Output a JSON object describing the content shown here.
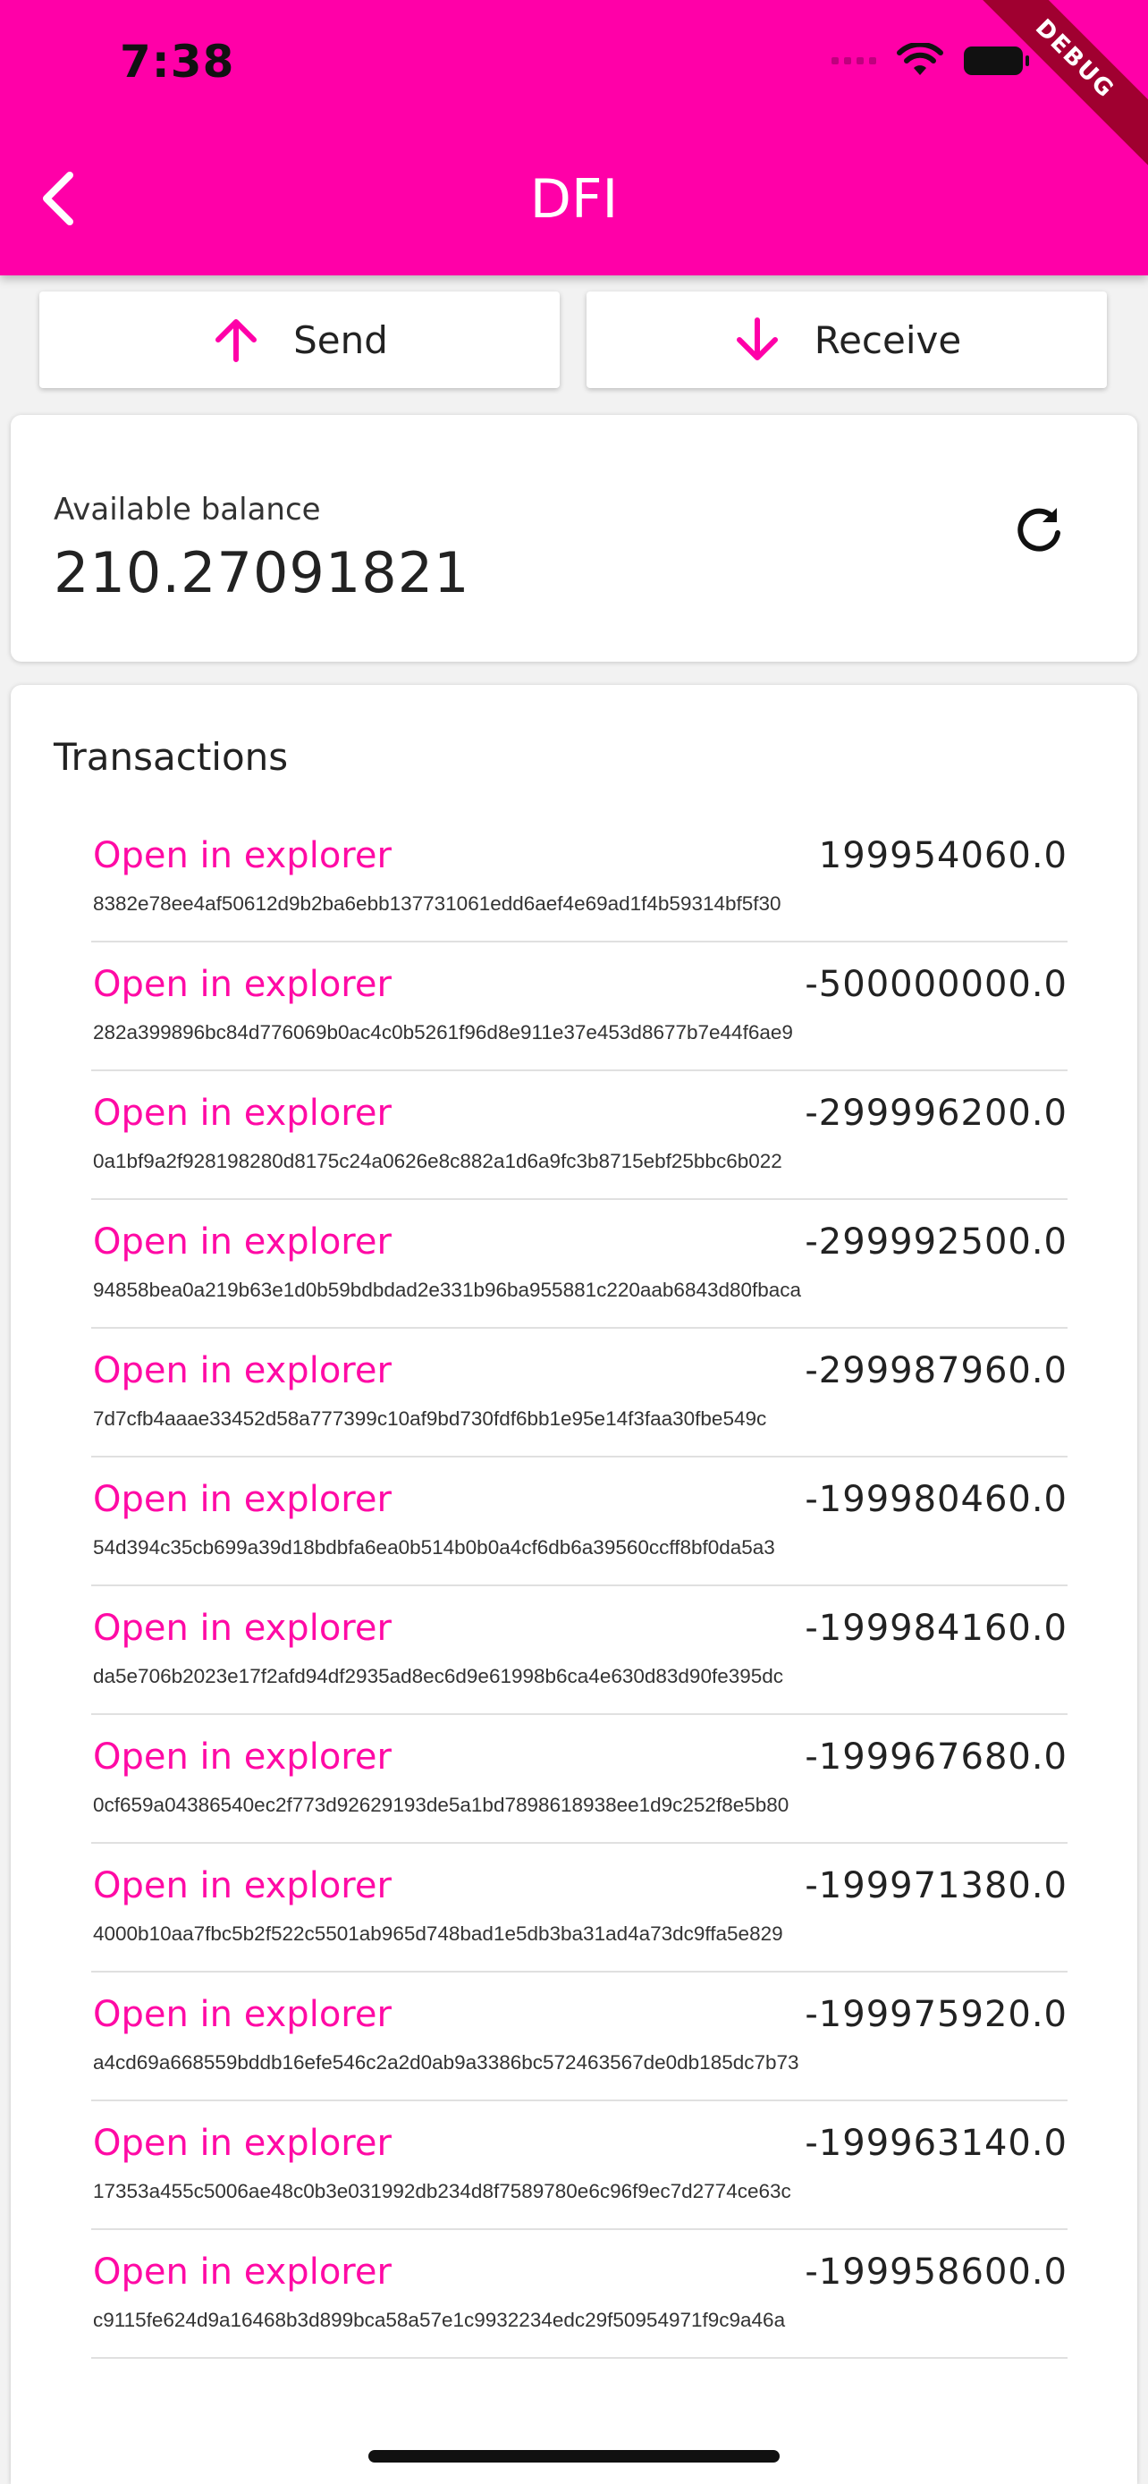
{
  "status_bar": {
    "time": "7:38"
  },
  "debug_banner": "DEBUG",
  "app_bar": {
    "title": "DFI"
  },
  "actions": {
    "send_label": "Send",
    "receive_label": "Receive"
  },
  "balance": {
    "label": "Available balance",
    "value": "210.27091821"
  },
  "transactions": {
    "heading": "Transactions",
    "link_label": "Open in explorer",
    "items": [
      {
        "amount": "199954060.0",
        "hash": "8382e78ee4af50612d9b2ba6ebb137731061edd6aef4e69ad1f4b59314bf5f30"
      },
      {
        "amount": "-500000000.0",
        "hash": "282a399896bc84d776069b0ac4c0b5261f96d8e911e37e453d8677b7e44f6ae9"
      },
      {
        "amount": "-299996200.0",
        "hash": "0a1bf9a2f928198280d8175c24a0626e8c882a1d6a9fc3b8715ebf25bbc6b022"
      },
      {
        "amount": "-299992500.0",
        "hash": "94858bea0a219b63e1d0b59bdbdad2e331b96ba955881c220aab6843d80fbaca"
      },
      {
        "amount": "-299987960.0",
        "hash": "7d7cfb4aaae33452d58a777399c10af9bd730fdf6bb1e95e14f3faa30fbe549c"
      },
      {
        "amount": "-199980460.0",
        "hash": "54d394c35cb699a39d18bdbfa6ea0b514b0b0a4cf6db6a39560ccff8bf0da5a3"
      },
      {
        "amount": "-199984160.0",
        "hash": "da5e706b2023e17f2afd94df2935ad8ec6d9e61998b6ca4e630d83d90fe395dc"
      },
      {
        "amount": "-199967680.0",
        "hash": "0cf659a04386540ec2f773d92629193de5a1bd7898618938ee1d9c252f8e5b80"
      },
      {
        "amount": "-199971380.0",
        "hash": "4000b10aa7fbc5b2f522c5501ab965d748bad1e5db3ba31ad4a73dc9ffa5e829"
      },
      {
        "amount": "-199975920.0",
        "hash": "a4cd69a668559bddb16efe546c2a2d0ab9a3386bc572463567de0db185dc7b73"
      },
      {
        "amount": "-199963140.0",
        "hash": "17353a455c5006ae48c0b3e031992db234d8f7589780e6c96f9ec7d2774ce63c"
      },
      {
        "amount": "-199958600.0",
        "hash": "c9115fe624d9a16468b3d899bca58a57e1c9932234edc29f50954971f9c9a46a"
      }
    ]
  },
  "icons": {
    "back": "chevron-left-icon",
    "send": "arrow-up-icon",
    "receive": "arrow-down-icon",
    "refresh": "refresh-icon"
  },
  "colors": {
    "accent": "#ff00a8",
    "link": "#ff0aa5",
    "debug": "#a00030"
  }
}
